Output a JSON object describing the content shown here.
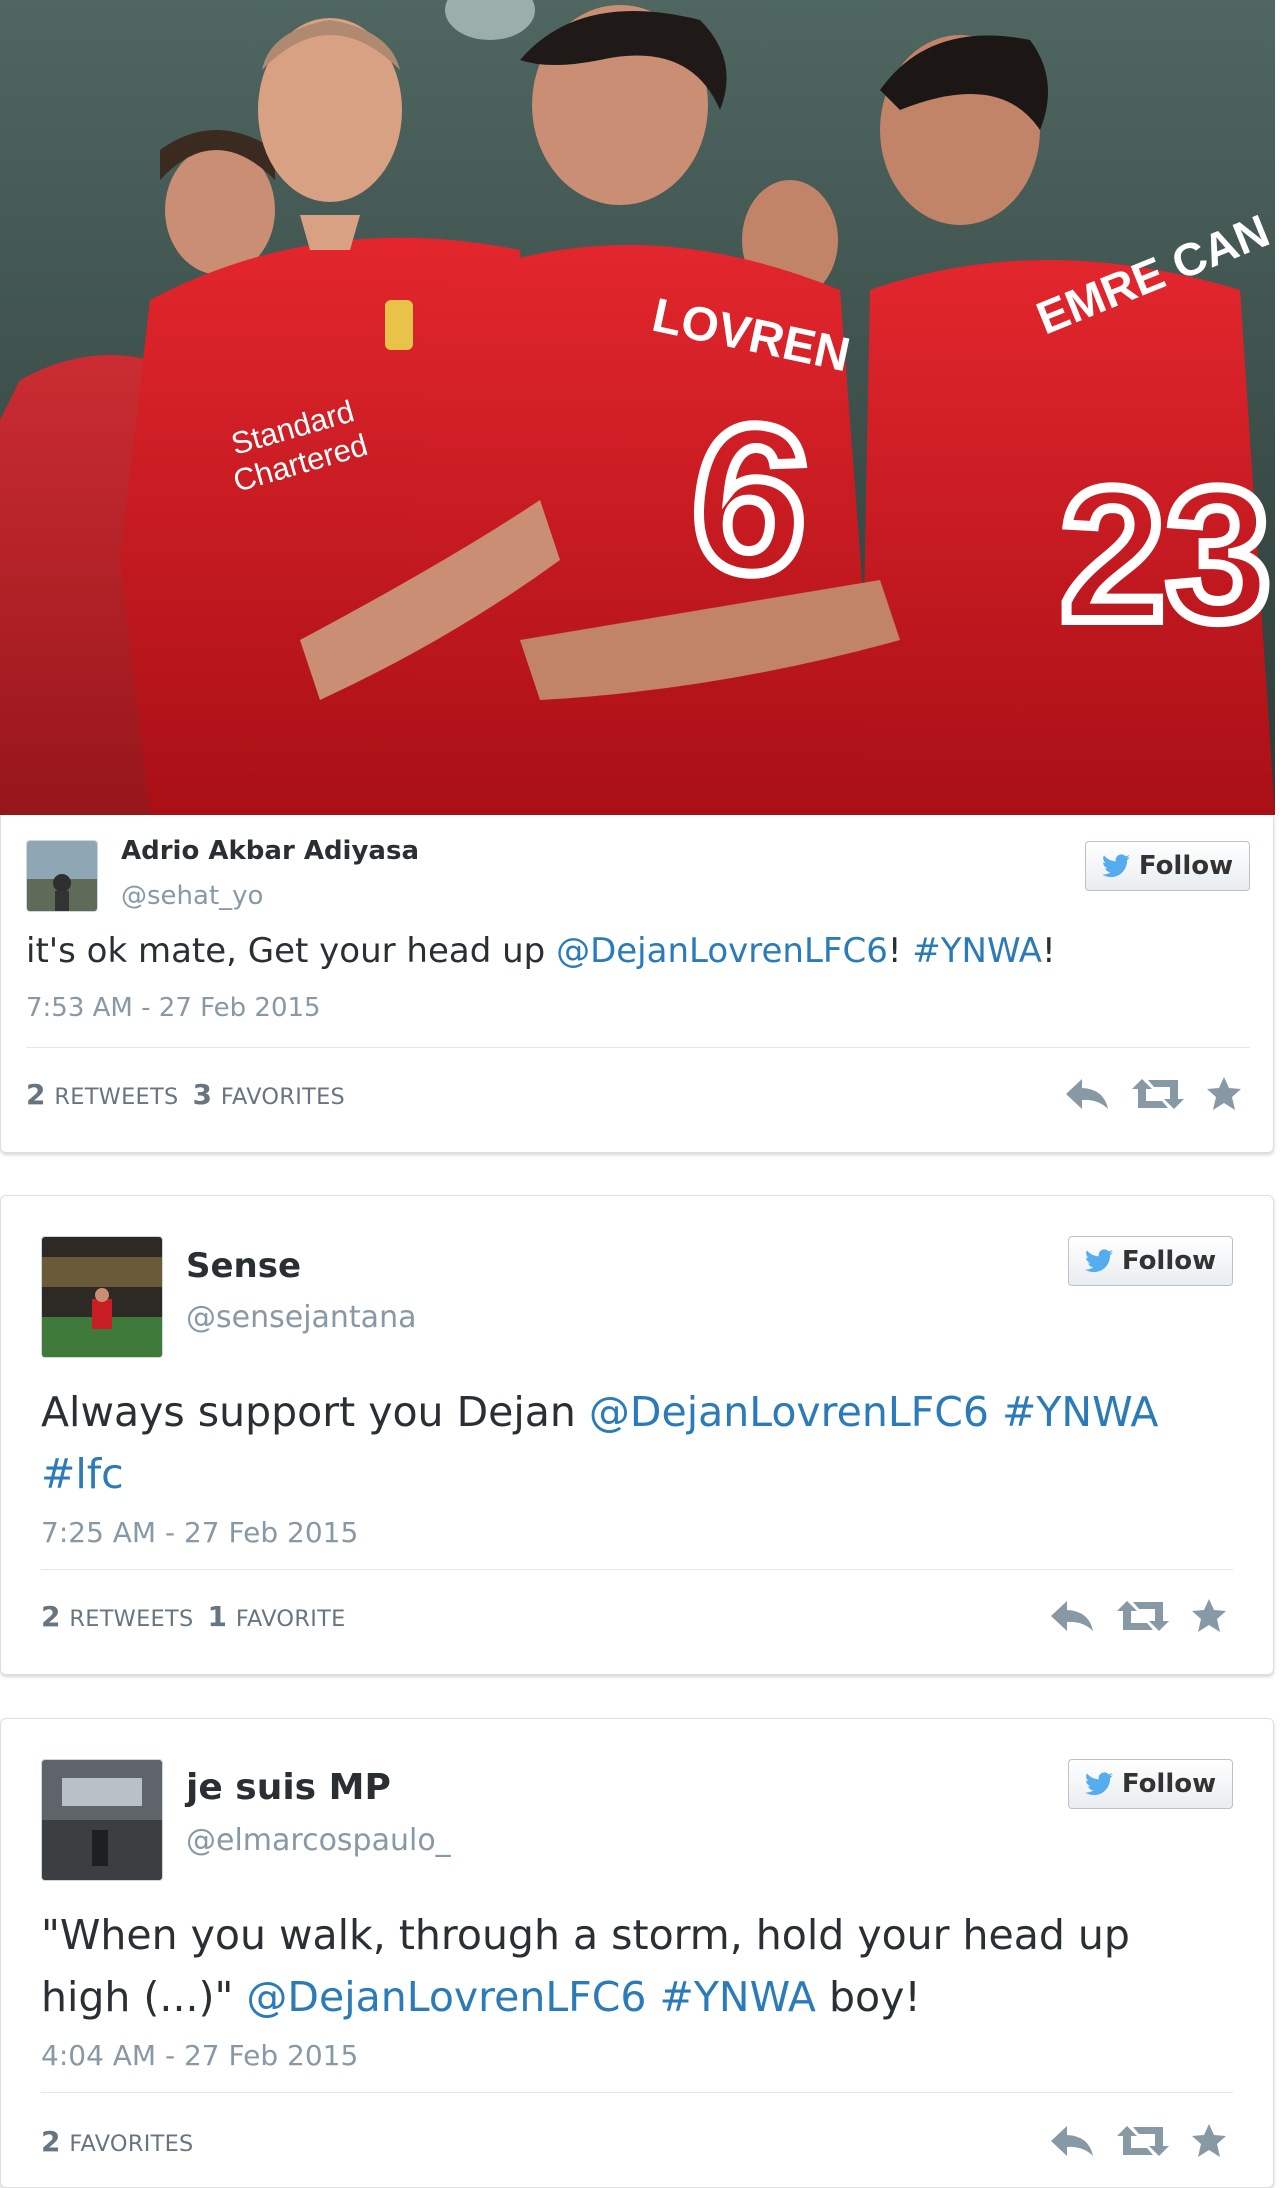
{
  "hero": {
    "jersey_names": [
      "LOVREN",
      "EMRE CAN"
    ],
    "jersey_numbers": [
      "6",
      "23"
    ],
    "sponsor": [
      "Standard",
      "Chartered"
    ]
  },
  "tweets": [
    {
      "name": "Adrio Akbar Adiyasa",
      "handle": "@sehat_yo",
      "follow": "Follow",
      "text": {
        "t1": "it's ok mate, Get your head up ",
        "mention": "@DejanLovrenLFC6",
        "t2": "! ",
        "tag1": "#YNWA",
        "t3": "!"
      },
      "time": "7:53 AM - 27 Feb 2015",
      "retweets": "2",
      "retweets_label": "RETWEETS",
      "favorites": "3",
      "favorites_label": "FAVORITES"
    },
    {
      "name": "Sense",
      "handle": "@sensejantana",
      "follow": "Follow",
      "text": {
        "t1": "Always support you Dejan ",
        "mention": "@DejanLovrenLFC6",
        "t2": " ",
        "tag1": "#YNWA",
        "t3": " ",
        "tag2": "#lfc"
      },
      "time": "7:25 AM - 27 Feb 2015",
      "retweets": "2",
      "retweets_label": "RETWEETS",
      "favorites": "1",
      "favorites_label": "FAVORITE"
    },
    {
      "name": "je suis MP",
      "handle": "@elmarcospaulo_",
      "follow": "Follow",
      "text": {
        "t1": "\"When you walk, through a storm, hold your head up high (...)\" ",
        "mention": "@DejanLovrenLFC6",
        "t2": " ",
        "tag1": "#YNWA",
        "t3": " boy!"
      },
      "time": "4:04 AM - 27 Feb 2015",
      "favorites": "2",
      "favorites_label": "FAVORITES"
    }
  ],
  "colors": {
    "link": "#2b7bb9",
    "twitter_blue": "#55acee",
    "liverpool_red": "#d2171e"
  },
  "icons": [
    "twitter-bird-icon",
    "reply-icon",
    "retweet-icon",
    "favorite-star-icon"
  ]
}
